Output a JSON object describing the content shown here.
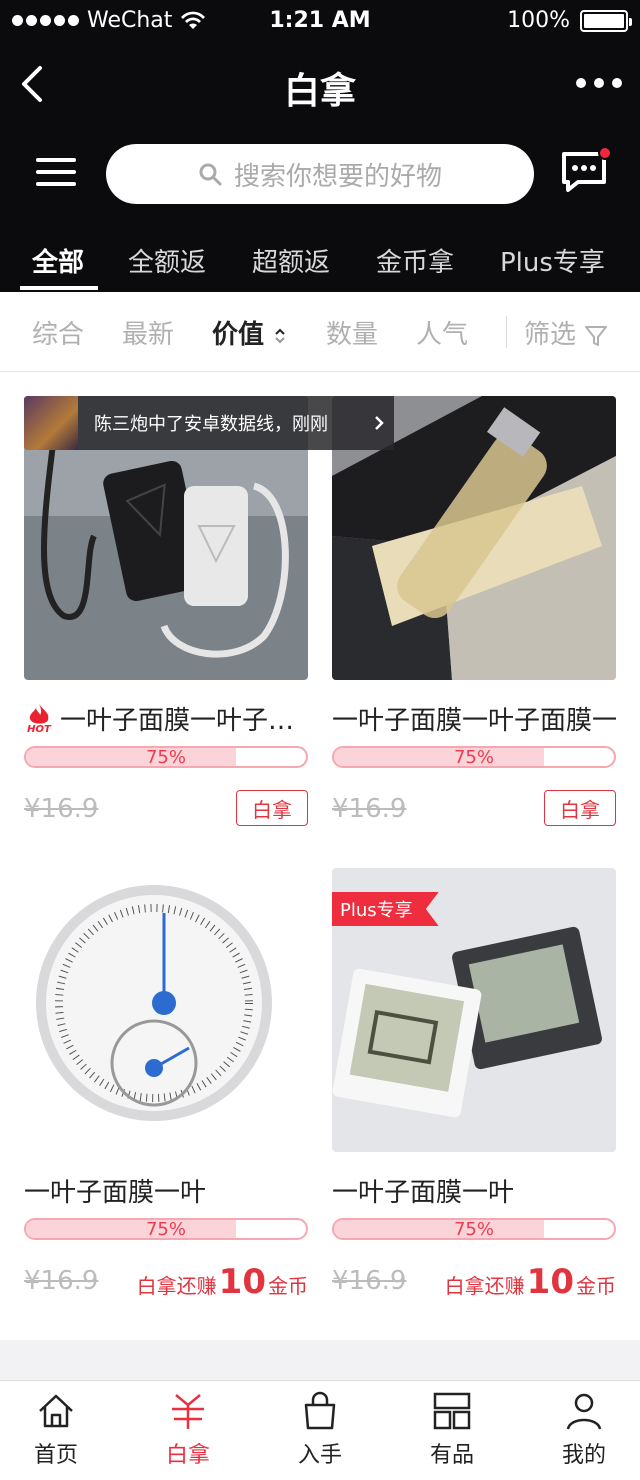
{
  "status_bar": {
    "carrier": "WeChat",
    "time": "1:21 AM",
    "battery": "100%"
  },
  "nav": {
    "title": "白拿"
  },
  "search": {
    "placeholder": "搜索你想要的好物"
  },
  "tabs": [
    "全部",
    "全额返",
    "超额返",
    "金币拿",
    "Plus专享"
  ],
  "sort": {
    "items": [
      "综合",
      "最新",
      "价值",
      "数量",
      "人气"
    ],
    "filter": "筛选",
    "active": "价值"
  },
  "ticker": {
    "text": "陈三炮中了安卓数据线，刚刚"
  },
  "products": [
    {
      "name": "一叶子面膜一叶子面膜一叶子面膜",
      "progress_label": "75%",
      "progress": 0.75,
      "price": "¥16.9",
      "action": "白拿",
      "badge": "HOT"
    },
    {
      "name": "一叶子面膜一叶子面膜一叶子面膜",
      "progress_label": "75%",
      "progress": 0.75,
      "price": "¥16.9",
      "action": "白拿"
    },
    {
      "name": "一叶子面膜一叶",
      "progress_label": "75%",
      "progress": 0.75,
      "price": "¥16.9",
      "earn_prefix": "白拿还赚",
      "earn_num": "10",
      "earn_unit": "金币"
    },
    {
      "name": "一叶子面膜一叶",
      "progress_label": "75%",
      "progress": 0.75,
      "price": "¥16.9",
      "earn_prefix": "白拿还赚",
      "earn_num": "10",
      "earn_unit": "金币",
      "ribbon": "Plus专享"
    }
  ],
  "bottom_tabs": [
    {
      "label": "首页",
      "icon": "home-icon"
    },
    {
      "label": "白拿",
      "icon": "yen-icon"
    },
    {
      "label": "入手",
      "icon": "bag-icon"
    },
    {
      "label": "有品",
      "icon": "grid-icon"
    },
    {
      "label": "我的",
      "icon": "user-icon"
    }
  ],
  "colors": {
    "accent": "#ec2f3f",
    "header_bg": "#0b0b0d",
    "progress_fill": "#fbd4da"
  }
}
